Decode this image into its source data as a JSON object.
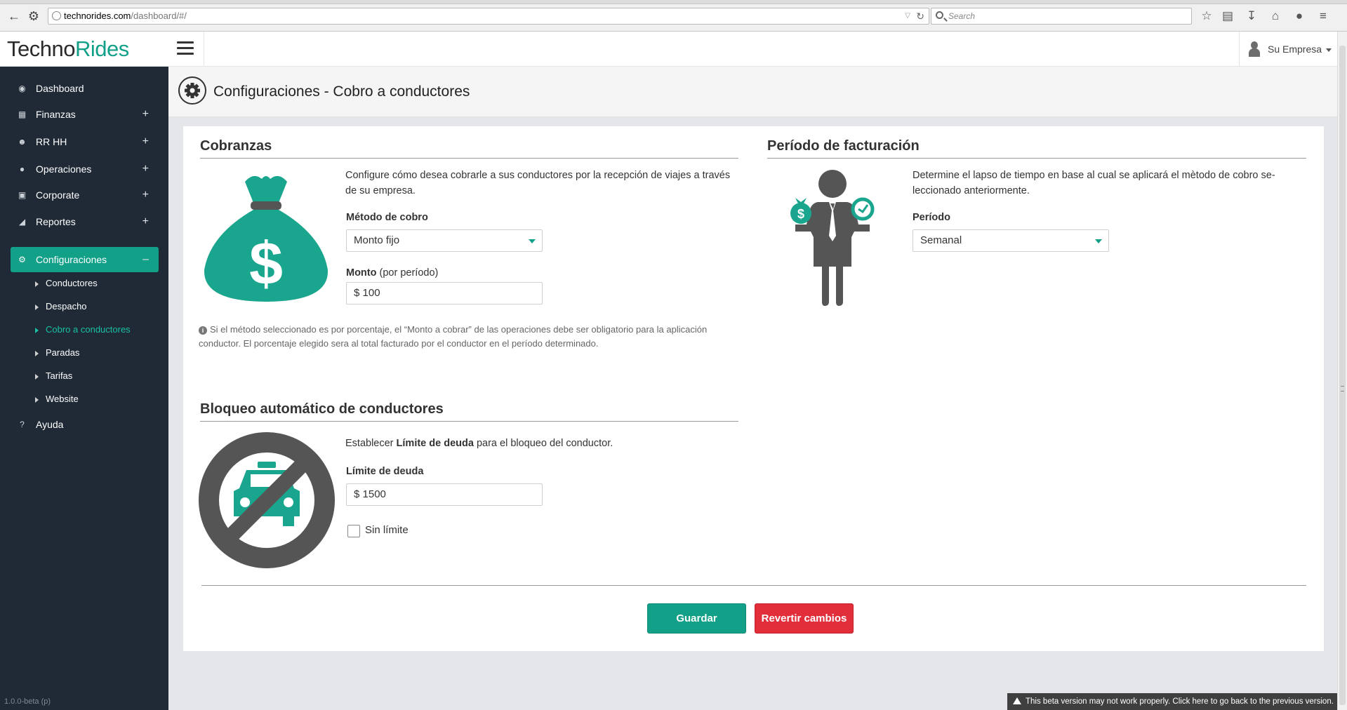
{
  "browser": {
    "url_domain": "technorides.com",
    "url_path": "/dashboard/#/",
    "search_placeholder": "Search"
  },
  "app": {
    "logo_part1": "Techno",
    "logo_part2": "Rides",
    "user_name": "Su Empresa",
    "accent_color": "#12a089",
    "danger_color": "#e22d3a",
    "sidebar_bg": "#1f2a36"
  },
  "sidebar": {
    "items": [
      {
        "label": "Dashboard",
        "icon": "dashboard-icon"
      },
      {
        "label": "Finanzas",
        "icon": "calculator-icon",
        "expand": "+"
      },
      {
        "label": "RR HH",
        "icon": "users-icon",
        "expand": "+"
      },
      {
        "label": "Operaciones",
        "icon": "map-marker-icon",
        "expand": "+"
      },
      {
        "label": "Corporate",
        "icon": "briefcase-icon",
        "expand": "+"
      },
      {
        "label": "Reportes",
        "icon": "area-chart-icon",
        "expand": "+"
      },
      {
        "label": "Configuraciones",
        "icon": "gear-icon",
        "expand": "–"
      },
      {
        "label": "Ayuda",
        "icon": "question-icon"
      }
    ],
    "sub_items": [
      {
        "label": "Conductores"
      },
      {
        "label": "Despacho"
      },
      {
        "label": "Cobro a conductores"
      },
      {
        "label": "Paradas"
      },
      {
        "label": "Tarifas"
      },
      {
        "label": "Website"
      }
    ],
    "version": "1.0.0-beta (p)"
  },
  "page": {
    "title": "Configuraciones - Cobro a conductores"
  },
  "cobranzas": {
    "title": "Cobranzas",
    "description": "Configure cómo desea cobrarle a sus conductores por la recepción de viajes a través de su empresa.",
    "method_label": "Método de cobro",
    "method_value": "Monto fijo",
    "amount_label": "Monto",
    "amount_label_suffix": "(por período)",
    "amount_value": "$ 100",
    "note": "Si el método seleccionado es por porcentaje, el “Monto a cobrar” de las operaciones debe ser obligatorio para la aplicación conductor. El porcentaje elegido sera al total facturado por el conductor en el período determinado."
  },
  "facturacion": {
    "title": "Período de facturación",
    "description": "Determine el lapso de tiempo en base al cual se aplicará el mètodo de cobro se-leccionado anteriormente.",
    "period_label": "Período",
    "period_value": "Semanal"
  },
  "bloqueo": {
    "title": "Bloqueo automático de conductores",
    "desc_prefix": "Establecer ",
    "desc_bold": "Límite de deuda",
    "desc_suffix": " para el bloqueo del conductor.",
    "limit_label": "Límite de deuda",
    "limit_value": "$ 1500",
    "no_limit_label": "Sin límite",
    "no_limit_checked": false
  },
  "actions": {
    "save_label": "Guardar",
    "revert_label": "Revertir cambios"
  },
  "beta_banner": "This beta version may not work properly. Click here to go back to the previous version."
}
